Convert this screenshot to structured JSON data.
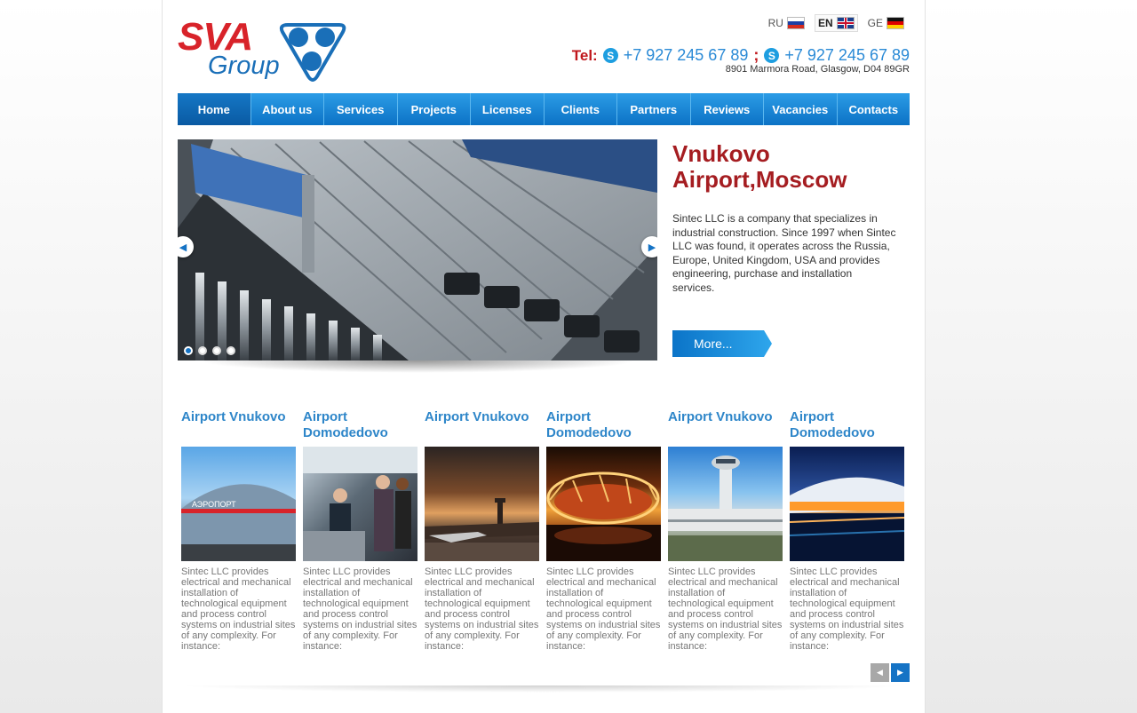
{
  "logo": {
    "main": "SVA",
    "sub": "Group"
  },
  "languages": [
    {
      "code": "RU",
      "active": false
    },
    {
      "code": "EN",
      "active": true
    },
    {
      "code": "GE",
      "active": false
    }
  ],
  "contact": {
    "tel_label": "Tel:",
    "phone1": "+7 927 245 67 89",
    "separator": ";",
    "phone2": "+7 927 245 67 89",
    "address": "8901 Marmora Road, Glasgow, D04 89GR"
  },
  "nav": [
    "Home",
    "About us",
    "Services",
    "Projects",
    "Licenses",
    "Clients",
    "Partners",
    "Reviews",
    "Vacancies",
    "Contacts"
  ],
  "slider": {
    "slide_count": 4,
    "active_index": 0
  },
  "intro": {
    "title": "Vnukovo Airport,Moscow",
    "text": "Sintec LLC is a company that specializes in industrial construction. Since 1997 when Sintec LLC was found, it operates across the Russia, Europe, United Kingdom, USA and provides engineering, purchase and installation services.",
    "button": "More..."
  },
  "cards": [
    {
      "title": "Airport Vnukovo",
      "text": "Sintec LLC provides electrical and mechanical installation of technological equipment and process control systems on industrial sites of any complexity. For instance:"
    },
    {
      "title": "Airport Domodedovo",
      "text": "Sintec LLC provides electrical and mechanical installation of technological equipment and process control systems on industrial sites of any complexity. For instance:"
    },
    {
      "title": "Airport Vnukovo",
      "text": "Sintec LLC provides electrical and mechanical installation of technological equipment and process control systems on industrial sites of any complexity. For instance:"
    },
    {
      "title": "Airport Domodedovo",
      "text": "Sintec LLC provides electrical and mechanical installation of technological equipment and process control systems on industrial sites of any complexity. For instance:"
    },
    {
      "title": "Airport Vnukovo",
      "text": "Sintec LLC provides electrical and mechanical installation of technological equipment and process control systems on industrial sites of any complexity. For instance:"
    },
    {
      "title": "Airport Domodedovo",
      "text": "Sintec LLC provides electrical and mechanical installation of technological equipment and process control systems on industrial sites of any complexity. For instance:"
    }
  ],
  "colors": {
    "brand_red": "#d8232a",
    "brand_blue": "#1573c5",
    "title_red": "#a51d21",
    "card_title_blue": "#2e86c9"
  },
  "icons": {
    "skype": "skype-icon",
    "prev": "arrow-left-icon",
    "next": "arrow-right-icon"
  }
}
